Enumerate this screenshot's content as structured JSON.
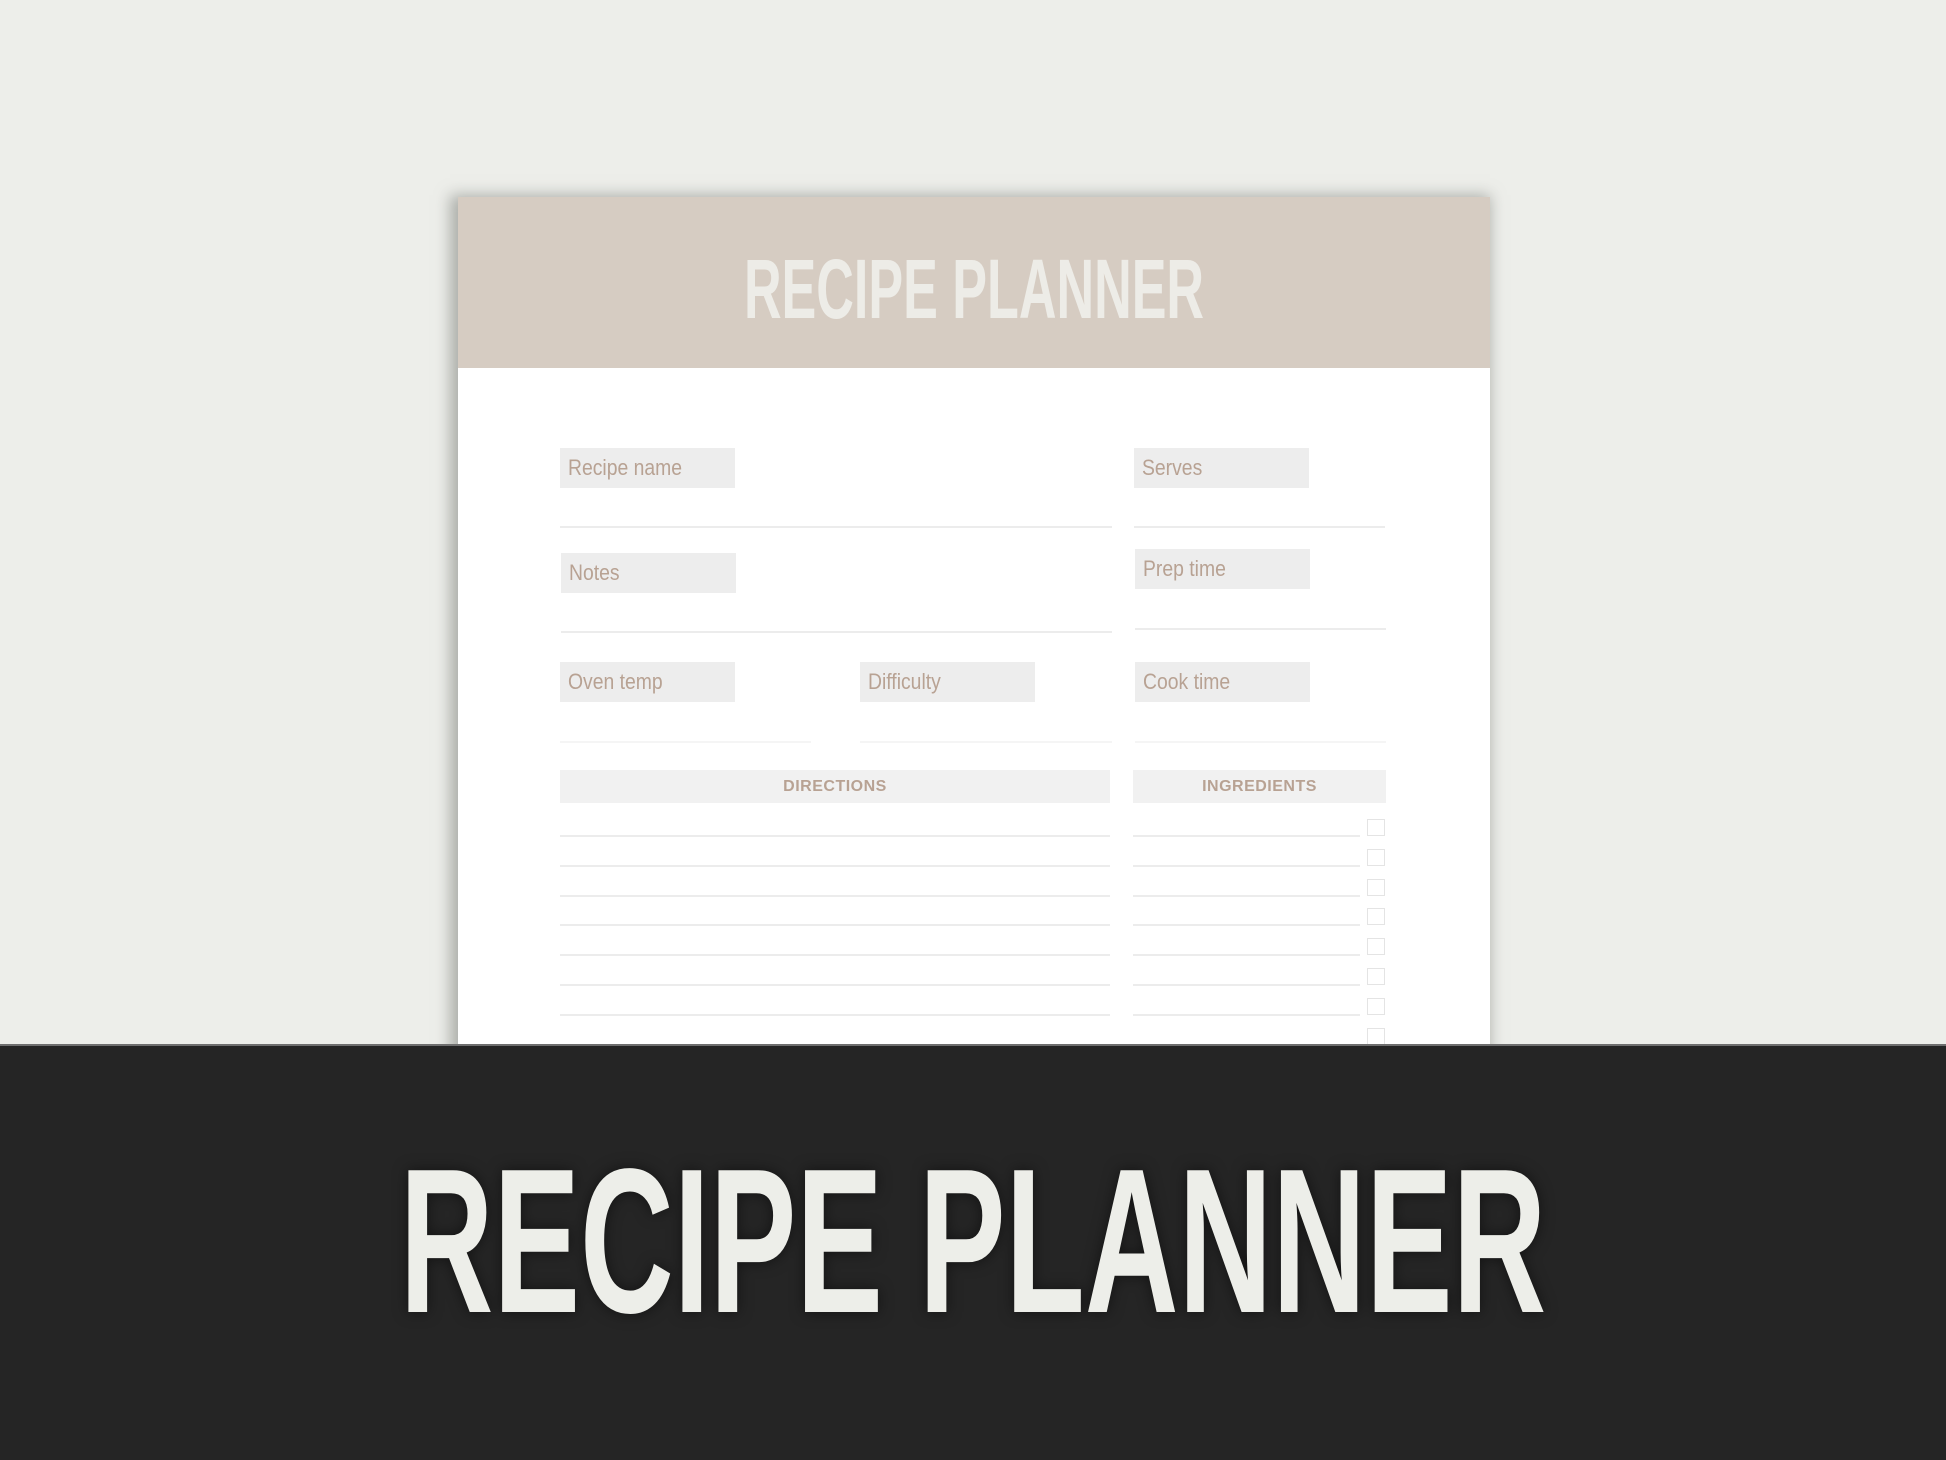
{
  "document": {
    "title": "RECIPE PLANNER",
    "fields": {
      "recipe_name": "Recipe name",
      "serves": "Serves",
      "notes": "Notes",
      "prep_time": "Prep time",
      "oven_temp": "Oven temp",
      "difficulty": "Difficulty",
      "cook_time": "Cook time"
    },
    "sections": {
      "directions": "DIRECTIONS",
      "ingredients": "INGREDIENTS"
    },
    "direction_lines": 7,
    "ingredient_rows": 8
  },
  "banner": {
    "title": "RECIPE PLANNER"
  },
  "colors": {
    "background": "#edeeea",
    "header": "#d6ccc2",
    "label_text": "#b8a293",
    "label_bg": "#ededed",
    "banner": "#252525",
    "title_text": "#edece7"
  }
}
